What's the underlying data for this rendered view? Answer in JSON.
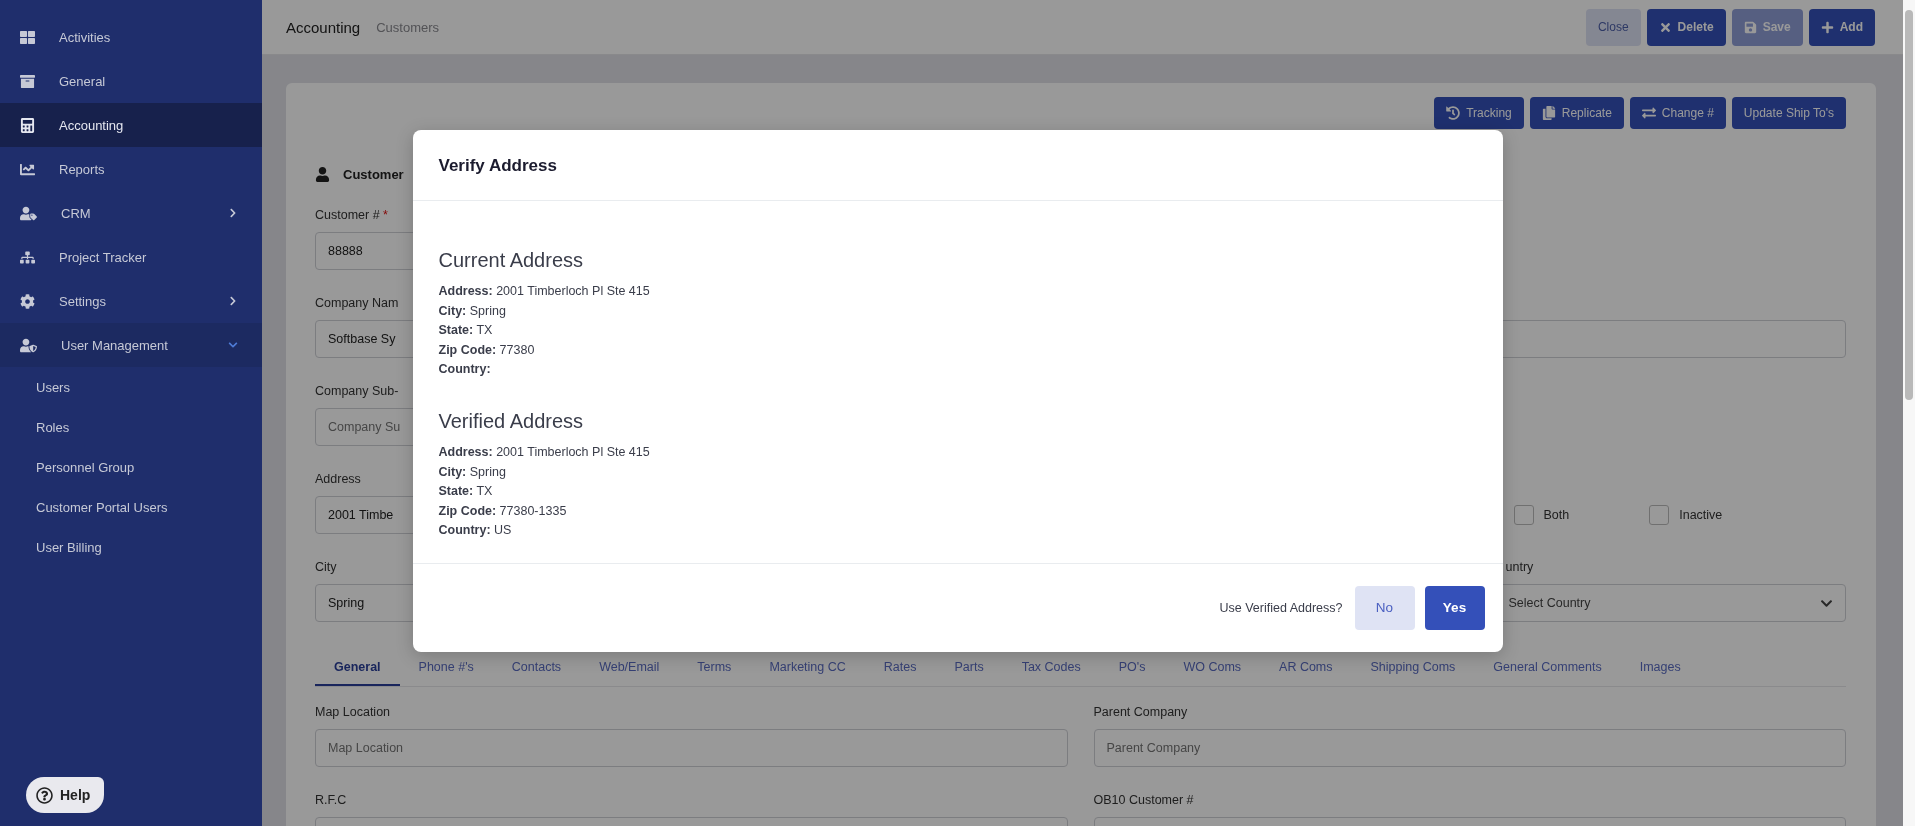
{
  "sidebar": {
    "items": [
      {
        "label": "Activities",
        "kind": "link",
        "selected": false
      },
      {
        "label": "General",
        "kind": "link",
        "selected": false
      },
      {
        "label": "Accounting",
        "kind": "link",
        "selected": true
      },
      {
        "label": "Reports",
        "kind": "link",
        "selected": false
      },
      {
        "label": "CRM",
        "kind": "group",
        "selected": false,
        "expanded": false
      },
      {
        "label": "Project Tracker",
        "kind": "link",
        "selected": false
      },
      {
        "label": "Settings",
        "kind": "group",
        "selected": false,
        "expanded": false
      },
      {
        "label": "User Management",
        "kind": "group",
        "selected": false,
        "expanded": true,
        "children": [
          {
            "label": "Users",
            "selected": false
          },
          {
            "label": "Roles",
            "selected": false
          },
          {
            "label": "Personnel Group",
            "selected": false
          },
          {
            "label": "Customer Portal Users",
            "selected": false
          },
          {
            "label": "User Billing",
            "selected": false
          }
        ]
      }
    ],
    "help": "Help"
  },
  "topbar": {
    "title": "Accounting",
    "breadcrumb": "Customers",
    "buttons": [
      {
        "label": "Close",
        "kind": "light",
        "disabled": false
      },
      {
        "label": "Delete",
        "kind": "primary",
        "disabled": false
      },
      {
        "label": "Save",
        "kind": "primary",
        "disabled": true
      },
      {
        "label": "Add",
        "kind": "primary",
        "disabled": false
      }
    ]
  },
  "card": {
    "actions": [
      "Tracking",
      "Replicate",
      "Change #",
      "Update Ship To's"
    ],
    "heading": "Customer",
    "rows": [
      {
        "left": {
          "label": "Customer #",
          "required_mark": "*",
          "value": "88888"
        }
      },
      {
        "left": {
          "label": "Company Nam",
          "value": "Softbase Sy"
        },
        "right": {
          "kind": "input"
        }
      },
      {
        "left": {
          "label": "Company Sub-",
          "placeholder": "Company Su"
        }
      },
      {
        "left": {
          "label": "Address",
          "value": "2001 Timbe"
        },
        "right": {
          "kind": "checkboxes",
          "options": [
            {
              "label": "Both",
              "checked": false
            },
            {
              "label": "Inactive",
              "checked": false
            }
          ]
        }
      },
      {
        "left": {
          "label": "City",
          "value": "Spring"
        },
        "right": {
          "kind": "select",
          "label": "untry",
          "placeholder": "Select Country"
        }
      }
    ],
    "tabs": [
      {
        "label": "General",
        "selected": true
      },
      {
        "label": "Phone #'s",
        "selected": false
      },
      {
        "label": "Contacts",
        "selected": false
      },
      {
        "label": "Web/Email",
        "selected": false
      },
      {
        "label": "Terms",
        "selected": false
      },
      {
        "label": "Marketing CC",
        "selected": false
      },
      {
        "label": "Rates",
        "selected": false
      },
      {
        "label": "Parts",
        "selected": false
      },
      {
        "label": "Tax Codes",
        "selected": false
      },
      {
        "label": "PO's",
        "selected": false
      },
      {
        "label": "WO Coms",
        "selected": false
      },
      {
        "label": "AR Coms",
        "selected": false
      },
      {
        "label": "Shipping Coms",
        "selected": false
      },
      {
        "label": "General Comments",
        "selected": false
      },
      {
        "label": "Images",
        "selected": false
      }
    ],
    "fields": [
      {
        "label": "Map Location",
        "placeholder": "Map Location"
      },
      {
        "label": "Parent Company",
        "placeholder": "Parent Company"
      },
      {
        "label": "R.F.C"
      },
      {
        "label": "OB10 Customer #"
      }
    ]
  },
  "modal": {
    "title": "Verify Address",
    "sections": [
      {
        "heading": "Current Address",
        "lines": [
          "**Address:** 2001 Timberloch Pl Ste 415",
          "**City:** Spring",
          "**State:** TX",
          "**Zip Code:** 77380",
          "**Country:**"
        ]
      },
      {
        "heading": "Verified Address",
        "lines": [
          "**Address:** 2001 Timberloch Pl Ste 415",
          "**City:** Spring",
          "**State:** TX",
          "**Zip Code:** 77380-1335",
          "**Country:** US"
        ]
      }
    ],
    "question": "Use Verified Address?",
    "buttons": [
      {
        "label": "No",
        "kind": "secondary"
      },
      {
        "label": "Yes",
        "kind": "primary"
      }
    ]
  }
}
